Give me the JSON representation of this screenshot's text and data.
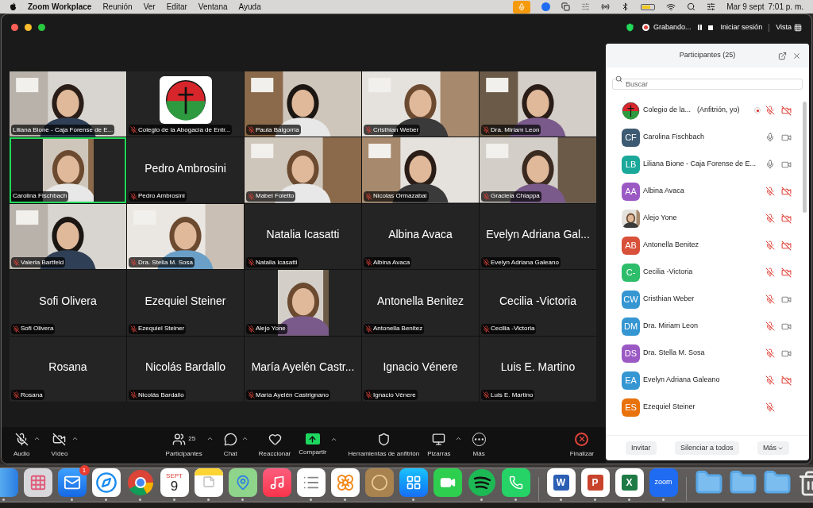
{
  "menu_bar": {
    "app_name": "Zoom Workplace",
    "menus": [
      "Reunión",
      "Ver",
      "Editar",
      "Ventana",
      "Ayuda"
    ],
    "date": "Mar 9 sept",
    "time": "7:01 p. m."
  },
  "window": {
    "recording_label": "Grabando...",
    "sign_in": "Iniciar sesión",
    "view": "Vista"
  },
  "tiles": [
    {
      "kind": "video",
      "label": "Liliana Bione - Caja Forense de E...",
      "muted": false,
      "speaking": false
    },
    {
      "kind": "logo",
      "label": "Colegio de la Abogacia de Entr...",
      "muted": true,
      "speaking": false
    },
    {
      "kind": "video",
      "label": "Paula Baigorria",
      "muted": true,
      "speaking": false
    },
    {
      "kind": "video",
      "label": "Cristhian Weber",
      "muted": true,
      "speaking": false
    },
    {
      "kind": "video",
      "label": "Dra. Miriam Leon",
      "muted": true,
      "speaking": false
    },
    {
      "kind": "small_video",
      "label": "Carolina Fischbach",
      "muted": false,
      "speaking": true
    },
    {
      "kind": "name",
      "display_name": "Pedro Ambrosini",
      "label": "Pedro Ambrosini",
      "muted": true,
      "speaking": false
    },
    {
      "kind": "video",
      "label": "Mabel Foletto",
      "muted": true,
      "speaking": false
    },
    {
      "kind": "video",
      "label": "Nicolas Ormazabal",
      "muted": true,
      "speaking": false
    },
    {
      "kind": "video",
      "label": "Graciela Chiappa",
      "muted": true,
      "speaking": false
    },
    {
      "kind": "video",
      "label": "Valeria Bartfeld",
      "muted": true,
      "speaking": false
    },
    {
      "kind": "video",
      "label": "Dra. Stella M. Sosa",
      "muted": true,
      "speaking": false
    },
    {
      "kind": "name",
      "display_name": "Natalia Icasatti",
      "label": "Natalia Icasatti",
      "muted": true,
      "speaking": false
    },
    {
      "kind": "name",
      "display_name": "Albina Avaca",
      "label": "Albina Avaca",
      "muted": true,
      "speaking": false
    },
    {
      "kind": "name",
      "display_name": "Evelyn Adriana Gal...",
      "label": "Evelyn Adriana Galeano",
      "muted": true,
      "speaking": false
    },
    {
      "kind": "name",
      "display_name": "Sofi Olivera",
      "label": "Sofi Olivera",
      "muted": true,
      "speaking": false
    },
    {
      "kind": "name",
      "display_name": "Ezequiel Steiner",
      "label": "Ezequiel Steiner",
      "muted": true,
      "speaking": false
    },
    {
      "kind": "small_video",
      "label": "Alejo Yone",
      "muted": true,
      "speaking": false
    },
    {
      "kind": "name",
      "display_name": "Antonella Benitez",
      "label": "Antonella Benitez",
      "muted": true,
      "speaking": false
    },
    {
      "kind": "name",
      "display_name": "Cecilia -Victoria",
      "label": "Cecilia -Victoria",
      "muted": true,
      "speaking": false
    },
    {
      "kind": "name",
      "display_name": "Rosana",
      "label": "Rosana",
      "muted": true,
      "speaking": false
    },
    {
      "kind": "name",
      "display_name": "Nicolás Bardallo",
      "label": "Nicolás Bardallo",
      "muted": true,
      "speaking": false
    },
    {
      "kind": "name",
      "display_name": "María Ayelén Castr...",
      "label": "María Ayelén Castrignano",
      "muted": true,
      "speaking": false
    },
    {
      "kind": "name",
      "display_name": "Ignacio Vénere",
      "label": "Ignacio Vénere",
      "muted": true,
      "speaking": false
    },
    {
      "kind": "name",
      "display_name": "Luis E. Martino",
      "label": "Luis E. Martino",
      "muted": true,
      "speaking": false
    }
  ],
  "participants": {
    "title": "Participantes (25)",
    "search_placeholder": "Buscar",
    "rows": [
      {
        "kind": "logo",
        "name": "Colegio de la...",
        "note": "(Anfitrión, yo)",
        "recording": true,
        "muted": true,
        "video_icon": true,
        "video_off": true
      },
      {
        "kind": "initials",
        "initials": "CF",
        "color": "#3d5a73",
        "name": "Carolina Fischbach",
        "recording": false,
        "muted": false,
        "video_icon": true,
        "video_off": false
      },
      {
        "kind": "initials",
        "initials": "LB",
        "color": "#1aa89a",
        "name": "Liliana Bione - Caja Forense de E...",
        "recording": false,
        "muted": false,
        "video_icon": true,
        "video_off": false
      },
      {
        "kind": "initials",
        "initials": "AA",
        "color": "#9b59c4",
        "name": "Albina Avaca",
        "recording": false,
        "muted": true,
        "video_icon": true,
        "video_off": true
      },
      {
        "name": "Alejo Yone",
        "recording": false,
        "muted": true,
        "video_icon": true,
        "video_off": true
      },
      {
        "kind": "initials",
        "initials": "AB",
        "color": "#d9503a",
        "name": "Antonella Benitez",
        "recording": false,
        "muted": true,
        "video_icon": true,
        "video_off": true
      },
      {
        "kind": "initials",
        "initials": "C-",
        "color": "#2ebd6b",
        "name": "Cecilia -Victoria",
        "recording": false,
        "muted": true,
        "video_icon": true,
        "video_off": true
      },
      {
        "kind": "initials",
        "initials": "CW",
        "color": "#3596d2",
        "name": "Cristhian Weber",
        "recording": false,
        "muted": true,
        "video_icon": true,
        "video_off": false
      },
      {
        "kind": "initials",
        "initials": "DM",
        "color": "#3596d2",
        "name": "Dra. Miriam Leon",
        "recording": false,
        "muted": true,
        "video_icon": true,
        "video_off": false
      },
      {
        "kind": "initials",
        "initials": "DS",
        "color": "#9b59c4",
        "name": "Dra. Stella M. Sosa",
        "recording": false,
        "muted": true,
        "video_icon": true,
        "video_off": false
      },
      {
        "kind": "initials",
        "initials": "EA",
        "color": "#3596d2",
        "name": "Evelyn Adriana Galeano",
        "recording": false,
        "muted": true,
        "video_icon": true,
        "video_off": true
      },
      {
        "kind": "initials",
        "initials": "ES",
        "color": "#e8720c",
        "name": "Ezequiel Steiner",
        "recording": false,
        "muted": true,
        "video_icon": false
      }
    ],
    "buttons": [
      {
        "label": "Invitar",
        "caret": false
      },
      {
        "label": "Silenciar a todos",
        "caret": false
      },
      {
        "label": "Más",
        "caret": true
      }
    ]
  },
  "toolbar": [
    {
      "kind": "audio",
      "label": "Audio",
      "off": true,
      "caret": true
    },
    {
      "kind": "video",
      "label": "Vídeo",
      "off": true,
      "caret": true
    },
    {
      "kind": "participants",
      "label": "Participantes",
      "count": "25",
      "caret": true
    },
    {
      "kind": "chat",
      "label": "Chat",
      "caret": true
    },
    {
      "kind": "react",
      "label": "Reaccionar",
      "caret": false
    },
    {
      "kind": "share",
      "label": "Compartir",
      "caret": true
    },
    {
      "kind": "host",
      "label": "Herramientas de anfitrión",
      "caret": false
    },
    {
      "kind": "whiteboard",
      "label": "Pizarras",
      "caret": true
    },
    {
      "kind": "more",
      "label": "Más",
      "caret": false
    },
    {
      "kind": "end",
      "label": "Finalizar",
      "caret": false
    }
  ],
  "dock": [
    {
      "kind": "finder",
      "running": true
    },
    {
      "kind": "launchpad",
      "running": false
    },
    {
      "kind": "mail",
      "running": true,
      "badge": "1"
    },
    {
      "kind": "safari",
      "running": true
    },
    {
      "kind": "chrome",
      "running": true
    },
    {
      "kind": "calendar",
      "running": true,
      "month": "SEPT",
      "day": "9"
    },
    {
      "kind": "notes",
      "running": true
    },
    {
      "kind": "maps",
      "running": true
    },
    {
      "kind": "music",
      "running": false
    },
    {
      "kind": "reminders",
      "running": true
    },
    {
      "kind": "photos",
      "running": true
    },
    {
      "kind": "book",
      "running": false
    },
    {
      "kind": "appstore",
      "running": true
    },
    {
      "kind": "facetime",
      "running": false
    },
    {
      "kind": "spotify",
      "running": true
    },
    {
      "kind": "whatsapp",
      "running": true
    },
    {
      "kind": "divider"
    },
    {
      "kind": "office",
      "running": true,
      "glyph": "W",
      "color": "#2b5fb4"
    },
    {
      "kind": "office",
      "running": true,
      "glyph": "P",
      "color": "#c8432b"
    },
    {
      "kind": "office",
      "running": true,
      "glyph": "X",
      "color": "#1e7a45"
    },
    {
      "kind": "zoom",
      "running": true,
      "text": "zoom"
    },
    {
      "kind": "divider"
    },
    {
      "kind": "folder",
      "running": false
    },
    {
      "kind": "folder",
      "running": false
    },
    {
      "kind": "folder",
      "running": false
    },
    {
      "kind": "trash",
      "running": false
    }
  ]
}
